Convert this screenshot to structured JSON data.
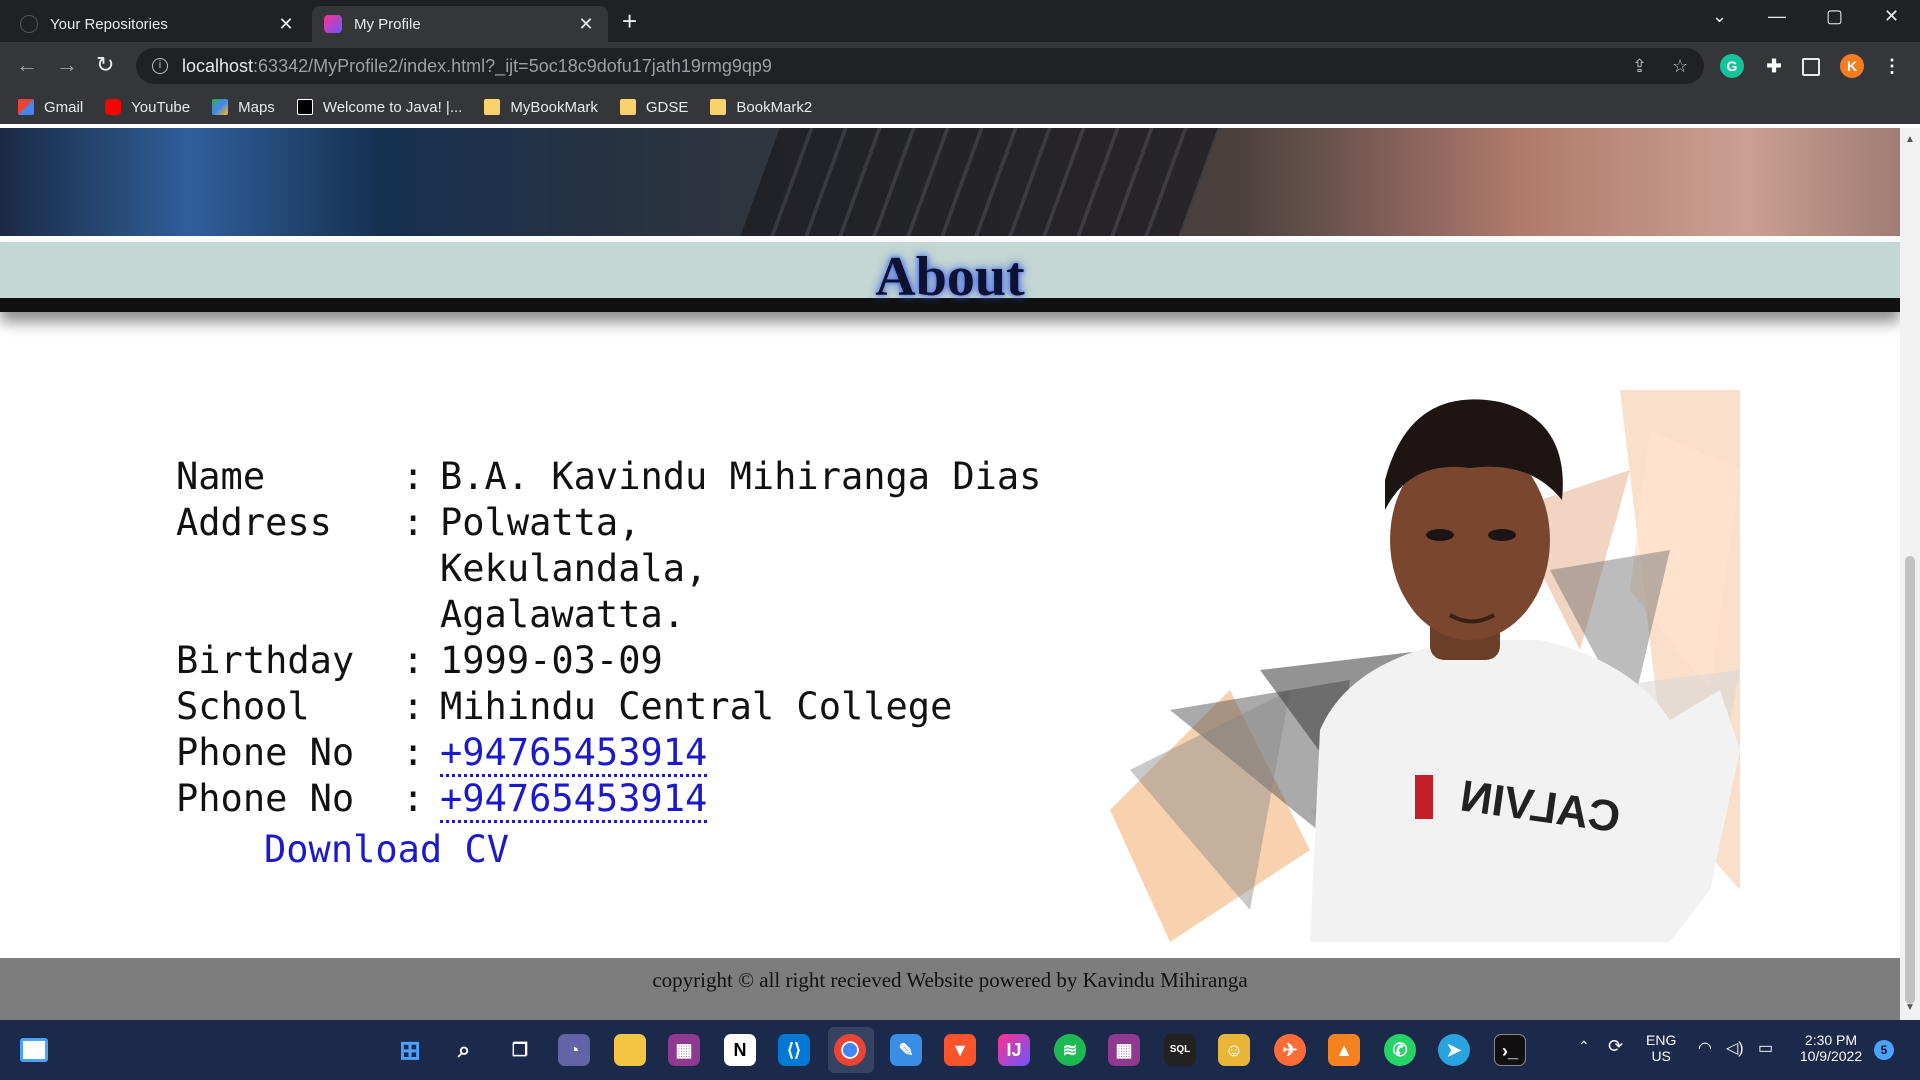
{
  "browser": {
    "tabs": [
      {
        "title": "Your Repositories",
        "active": false
      },
      {
        "title": "My Profile",
        "active": true
      }
    ],
    "address": {
      "host": "localhost",
      "path": ":63342/MyProfile2/index.html?_ijt=5oc18c9dofu17jath19rmg9qp9"
    },
    "profile_initial": "K",
    "bookmarks": [
      "Gmail",
      "YouTube",
      "Maps",
      "Welcome to Java! |...",
      "MyBookMark",
      "GDSE",
      "BookMark2"
    ]
  },
  "page": {
    "section_title": "About",
    "profile": [
      {
        "label": "Name",
        "colon": ":",
        "value": "B.A. Kavindu Mihiranga Dias"
      },
      {
        "label": "Address",
        "colon": ":",
        "value": "Polwatta,"
      },
      {
        "label": "",
        "colon": "",
        "value": "Kekulandala,"
      },
      {
        "label": "",
        "colon": "",
        "value": "Agalawatta."
      },
      {
        "label": "Birthday",
        "colon": ":",
        "value": "1999-03-09"
      },
      {
        "label": "School",
        "colon": ":",
        "value": "Mihindu Central College"
      },
      {
        "label": "Phone No",
        "colon": ":",
        "value": "+94765453914"
      },
      {
        "label": "Phone No",
        "colon": ":",
        "value": "+94765453914"
      }
    ],
    "download_label": "Download CV",
    "shirt_text": "CALVIN",
    "footer": "copyright © all right recieved Website powered by Kavindu Mihiranga"
  },
  "taskbar": {
    "lang": "ENG",
    "region": "US",
    "time": "2:30 PM",
    "date": "10/9/2022",
    "notifications": "5"
  },
  "colors": {
    "link": "#1a1acc",
    "band": "#c3d7d3",
    "footer": "#7d7d7d"
  }
}
